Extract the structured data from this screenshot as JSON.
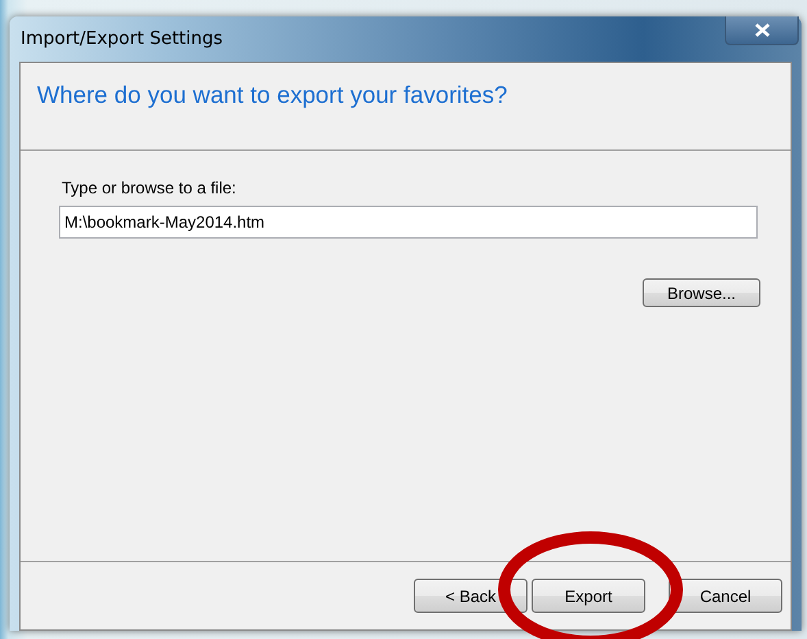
{
  "window": {
    "title": "Import/Export Settings"
  },
  "heading": "Where do you want to export your favorites?",
  "file_field": {
    "label": "Type or browse to a file:",
    "value": "M:\\bookmark-May2014.htm"
  },
  "browse_button": "Browse...",
  "buttons": [
    {
      "label": "< Back"
    },
    {
      "label": "Export"
    },
    {
      "label": "Cancel"
    }
  ]
}
